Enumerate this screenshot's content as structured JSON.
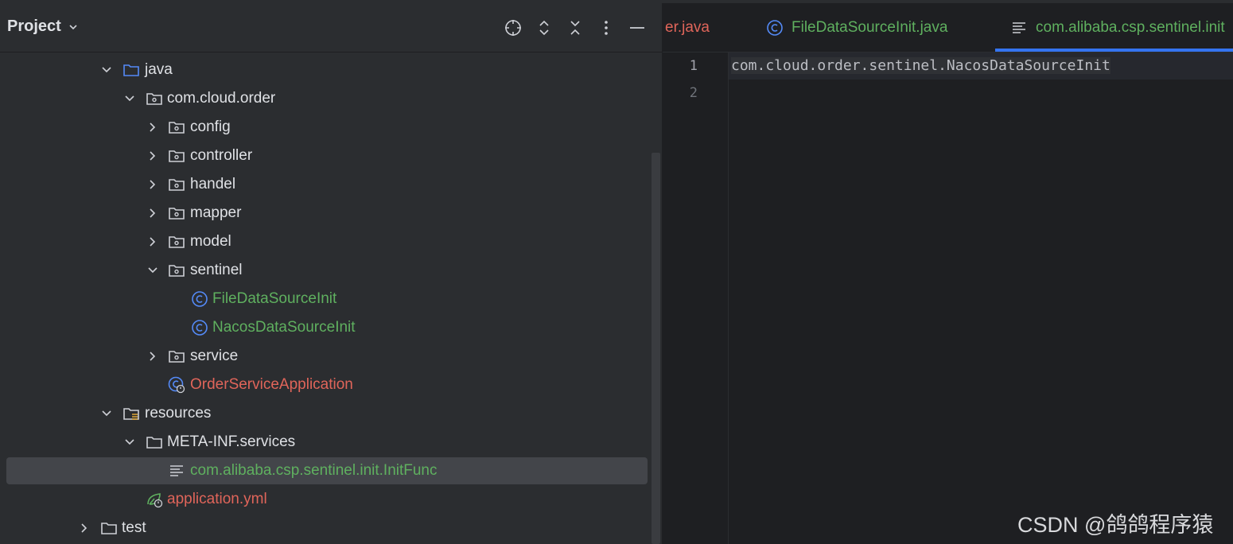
{
  "project_panel": {
    "title": "Project",
    "toolbar": [
      "locate-icon",
      "expand-collapse-icon",
      "collapse-all-icon",
      "more-options-icon",
      "hide-icon"
    ],
    "tree": [
      {
        "label": "java",
        "icon": "source-folder-icon",
        "expanded": true
      },
      {
        "label": "com.cloud.order",
        "icon": "package-icon",
        "expanded": true
      },
      {
        "label": "config",
        "icon": "package-icon",
        "expanded": false
      },
      {
        "label": "controller",
        "icon": "package-icon",
        "expanded": false
      },
      {
        "label": "handel",
        "icon": "package-icon",
        "expanded": false
      },
      {
        "label": "mapper",
        "icon": "package-icon",
        "expanded": false
      },
      {
        "label": "model",
        "icon": "package-icon",
        "expanded": false
      },
      {
        "label": "sentinel",
        "icon": "package-icon",
        "expanded": true
      },
      {
        "label": "FileDataSourceInit",
        "icon": "java-class-icon",
        "color": "#5fb05f"
      },
      {
        "label": "NacosDataSourceInit",
        "icon": "java-class-icon",
        "color": "#5fb05f"
      },
      {
        "label": "service",
        "icon": "package-icon",
        "expanded": false
      },
      {
        "label": "OrderServiceApplication",
        "icon": "spring-boot-class-icon",
        "color": "#e0655a"
      },
      {
        "label": "resources",
        "icon": "resources-folder-icon",
        "expanded": true
      },
      {
        "label": "META-INF.services",
        "icon": "folder-icon",
        "expanded": true
      },
      {
        "label": "com.alibaba.csp.sentinel.init.InitFunc",
        "icon": "text-file-icon",
        "color": "#5fb05f",
        "selected": true
      },
      {
        "label": "application.yml",
        "icon": "spring-yml-icon",
        "color": "#e0655a"
      },
      {
        "label": "test",
        "icon": "folder-icon",
        "expanded": false
      }
    ]
  },
  "editor": {
    "tabs": [
      {
        "label": "er.java",
        "color": "#e0655a",
        "icon": ""
      },
      {
        "label": "FileDataSourceInit.java",
        "color": "#5fb05f",
        "icon": "java-class-icon"
      },
      {
        "label": "com.alibaba.csp.sentinel.init",
        "color": "#5fb05f",
        "icon": "text-file-icon",
        "active": true
      }
    ],
    "line_numbers": [
      "1",
      "2"
    ],
    "lines": [
      "com.cloud.order.sentinel.NacosDataSourceInit",
      ""
    ]
  },
  "watermark": "CSDN @鸽鸽程序猿",
  "colors": {
    "panel_bg": "#2b2d30",
    "editor_bg": "#1e1f22",
    "text": "#dfe1e5",
    "modified_green": "#5fb05f",
    "error_red": "#e0655a",
    "accent_blue": "#3574f0",
    "selection": "#43454a"
  }
}
